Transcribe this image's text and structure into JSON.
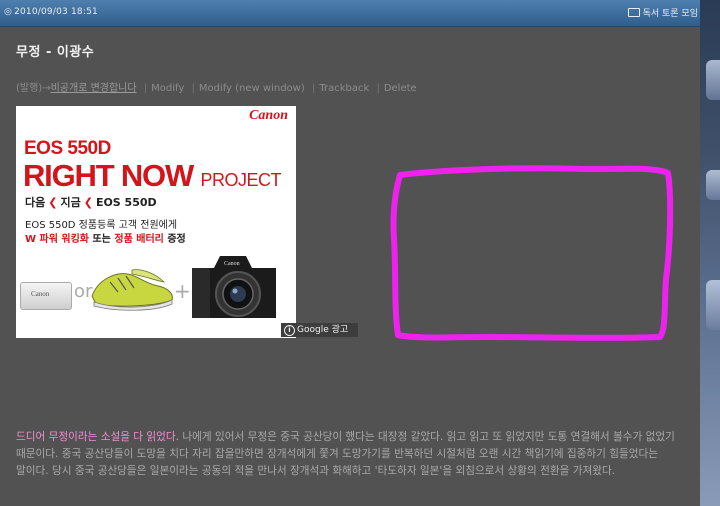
{
  "topbar": {
    "date": "2010/09/03 18:51",
    "date_icon": "clock-icon",
    "category_icon": "folder-icon",
    "category": "독서 토론 모임"
  },
  "post": {
    "title": "무정 - 이광수",
    "meta": {
      "privacy": "(발행)→",
      "make_private": "비공개로 변경합니다",
      "modify": "Modify",
      "modify_new_window": "Modify (new window)",
      "trackback": "Trackback",
      "delete": "Delete",
      "separator": "|"
    },
    "body_highlight": "드디어 무정이라는 소설을 다 읽었다.",
    "body_text": " 나에게 있어서 무정은 중국 공산당이 했다는 대장정 같았다. 읽고 읽고 또 읽었지만 도통 연결해서 볼수가 없었기 때문이다. 중국 공산당들이 도망을 치다 자리 잡을만하면 장개석에게 쫓겨 도망가기를 반복하던 시절처럼 오랜 시간 책읽기에 집중하기 힘들었다는 말이다. 당시 중국 공산당들은 일본이라는 공동의 적을 만나서 장개석과 화해하고 '타도하자 일본'을 외침으로서 상황의 전환을 가져왔다."
  },
  "ad": {
    "brand": "Canon",
    "model": "EOS 550D",
    "headline": "RIGHT NOW",
    "headline_small": "PROJECT",
    "sub_next": "다음",
    "sub_now": "지금",
    "sub_model": "EOS 550D",
    "line1": "EOS 550D 정품등록 고객 전원에게",
    "line2_a": "W 파워 워킹화",
    "line2_b": " 또는 ",
    "line2_c": "정품 배터리",
    "line2_d": " 증정",
    "battery_label": "Canon",
    "or": "or",
    "plus": "+",
    "google_label": "Google 광고",
    "accent": "#d4141b"
  },
  "colors": {
    "background": "#525252",
    "highlight": "#ef8fd2",
    "drawing": "#ee22ee"
  }
}
